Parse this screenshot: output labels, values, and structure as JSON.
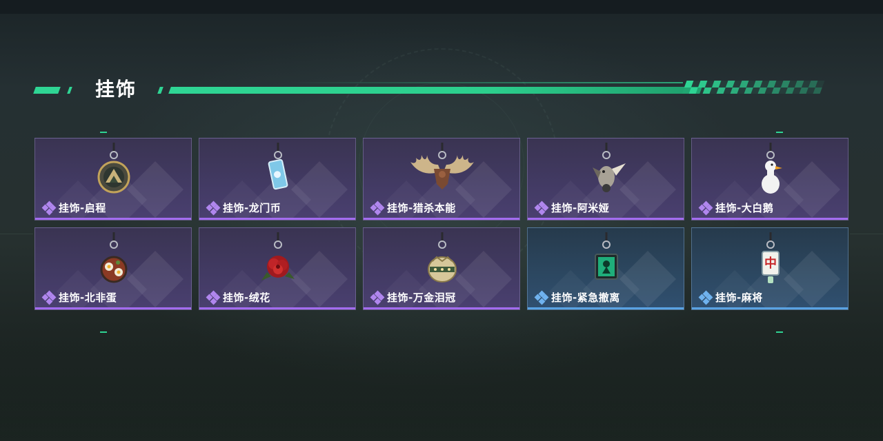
{
  "header": {
    "title": "挂饰"
  },
  "colors": {
    "accent": "#2fd594",
    "rarity_purple": "#a36cf0",
    "rarity_blue": "#5aa3e4"
  },
  "items": [
    {
      "label": "挂饰-启程",
      "rarity": "purple",
      "icon": "medallion-charm-icon"
    },
    {
      "label": "挂饰-龙门币",
      "rarity": "purple",
      "icon": "coin-tag-charm-icon"
    },
    {
      "label": "挂饰-猎杀本能",
      "rarity": "purple",
      "icon": "moose-antler-charm-icon"
    },
    {
      "label": "挂饰-阿米娅",
      "rarity": "purple",
      "icon": "bird-figure-charm-icon"
    },
    {
      "label": "挂饰-大白鹅",
      "rarity": "purple",
      "icon": "white-goose-charm-icon"
    },
    {
      "label": "挂饰-北非蛋",
      "rarity": "purple",
      "icon": "shakshuka-pan-charm-icon"
    },
    {
      "label": "挂饰-绒花",
      "rarity": "purple",
      "icon": "red-flower-charm-icon"
    },
    {
      "label": "挂饰-万金泪冠",
      "rarity": "purple",
      "icon": "golden-crown-charm-icon"
    },
    {
      "label": "挂饰-紧急撤离",
      "rarity": "blue",
      "icon": "green-emergency-charm-icon"
    },
    {
      "label": "挂饰-麻将",
      "rarity": "blue",
      "icon": "mahjong-tile-charm-icon",
      "tile_text": "中"
    }
  ]
}
